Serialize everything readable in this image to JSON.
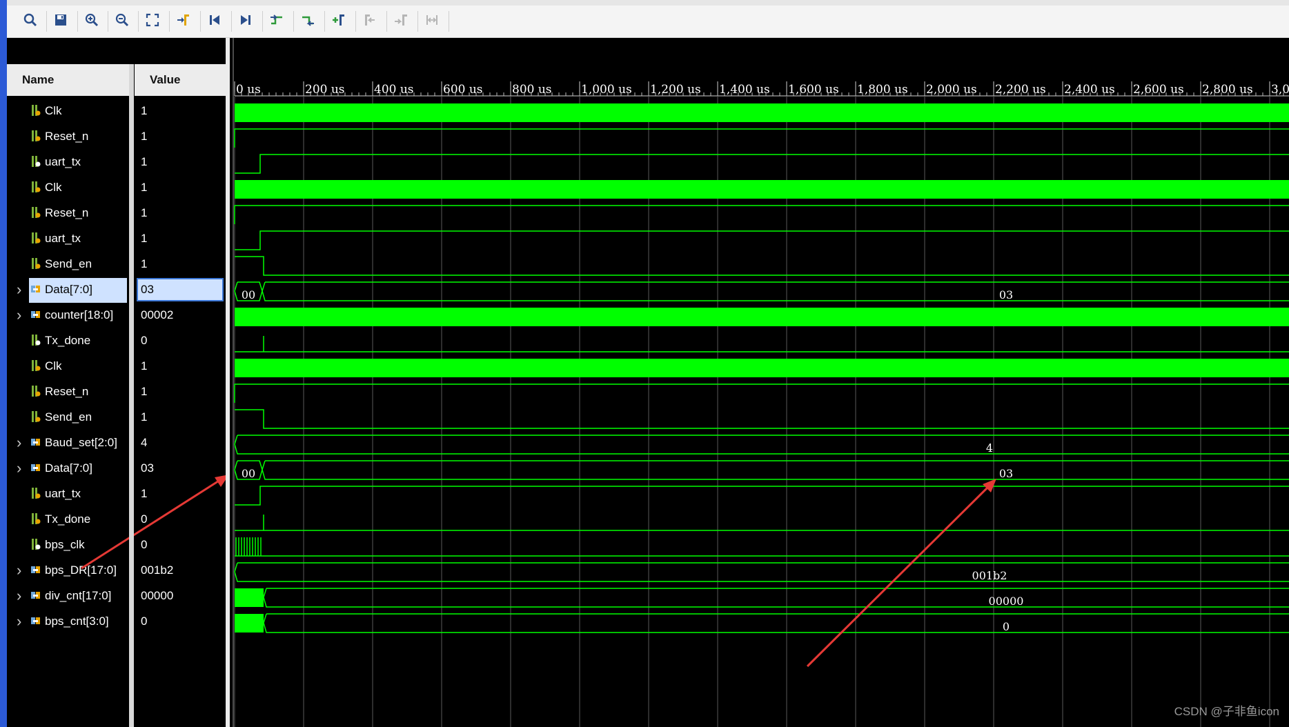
{
  "toolbar": {
    "buttons": [
      {
        "name": "search-button",
        "icon": "search-icon"
      },
      {
        "name": "save-button",
        "icon": "save-icon"
      },
      {
        "name": "zoom-in-button",
        "icon": "zoom-in-icon"
      },
      {
        "name": "zoom-out-button",
        "icon": "zoom-out-icon"
      },
      {
        "name": "zoom-fit-button",
        "icon": "zoom-fit-icon"
      },
      {
        "name": "go-to-cursor-button",
        "icon": "cursor-go-icon"
      },
      {
        "name": "go-to-time-zero-button",
        "icon": "skip-start-icon"
      },
      {
        "name": "go-to-last-time-button",
        "icon": "skip-end-icon"
      },
      {
        "name": "previous-transition-button",
        "icon": "prev-transition-icon"
      },
      {
        "name": "next-transition-button",
        "icon": "next-transition-icon"
      },
      {
        "name": "add-marker-button",
        "icon": "add-marker-icon"
      },
      {
        "name": "previous-marker-button",
        "icon": "prev-marker-icon",
        "disabled": true
      },
      {
        "name": "next-marker-button",
        "icon": "next-marker-icon",
        "disabled": true
      },
      {
        "name": "swap-cursors-button",
        "icon": "swap-cursor-icon",
        "disabled": true
      }
    ]
  },
  "columns": {
    "name": "Name",
    "value": "Value"
  },
  "timeline": {
    "labels": [
      "0 us",
      "200 us",
      "400 us",
      "600 us",
      "800 us",
      "1,000 us",
      "1,200 us",
      "1,400 us",
      "1,600 us",
      "1,800 us",
      "2,000 us",
      "2,200 us",
      "2,400 us",
      "2,600 us",
      "2,800 us",
      "3,0"
    ]
  },
  "signals": [
    {
      "name": "Clk",
      "value": "1",
      "icon": "input-signal-icon"
    },
    {
      "name": "Reset_n",
      "value": "1",
      "icon": "input-signal-icon"
    },
    {
      "name": "uart_tx",
      "value": "1",
      "icon": "output-signal-icon"
    },
    {
      "name": "Clk",
      "value": "1",
      "icon": "port-signal-icon"
    },
    {
      "name": "Reset_n",
      "value": "1",
      "icon": "port-signal-icon"
    },
    {
      "name": "uart_tx",
      "value": "1",
      "icon": "port-signal-icon"
    },
    {
      "name": "Send_en",
      "value": "1",
      "icon": "input-signal-icon"
    },
    {
      "name": "Data[7:0]",
      "value": "03",
      "icon": "bus-input-icon",
      "expandable": true,
      "selected": true,
      "bus_values": [
        "00",
        "03"
      ]
    },
    {
      "name": "counter[18:0]",
      "value": "00002",
      "icon": "bus-icon",
      "expandable": true
    },
    {
      "name": "Tx_done",
      "value": "0",
      "icon": "output-signal-icon"
    },
    {
      "name": "Clk",
      "value": "1",
      "icon": "port-signal-icon"
    },
    {
      "name": "Reset_n",
      "value": "1",
      "icon": "port-signal-icon"
    },
    {
      "name": "Send_en",
      "value": "1",
      "icon": "port-signal-icon"
    },
    {
      "name": "Baud_set[2:0]",
      "value": "4",
      "icon": "bus-port-icon",
      "expandable": true,
      "bus_values": [
        "4"
      ]
    },
    {
      "name": "Data[7:0]",
      "value": "03",
      "icon": "bus-port-icon",
      "expandable": true,
      "bus_values": [
        "00",
        "03"
      ]
    },
    {
      "name": "uart_tx",
      "value": "1",
      "icon": "port-signal-icon"
    },
    {
      "name": "Tx_done",
      "value": "0",
      "icon": "port-signal-icon"
    },
    {
      "name": "bps_clk",
      "value": "0",
      "icon": "output-signal-icon"
    },
    {
      "name": "bps_DR[17:0]",
      "value": "001b2",
      "icon": "bus-icon",
      "expandable": true,
      "bus_values": [
        "001b2"
      ]
    },
    {
      "name": "div_cnt[17:0]",
      "value": "00000",
      "icon": "bus-icon",
      "expandable": true,
      "bus_values": [
        "00000"
      ]
    },
    {
      "name": "bps_cnt[3:0]",
      "value": "0",
      "icon": "bus-icon",
      "expandable": true,
      "bus_values": [
        "0"
      ]
    }
  ],
  "watermark": "CSDN @子非鱼icon",
  "colors": {
    "wave": "#00ff00",
    "annotation": "#e53935",
    "selected": "#cfe2ff"
  }
}
